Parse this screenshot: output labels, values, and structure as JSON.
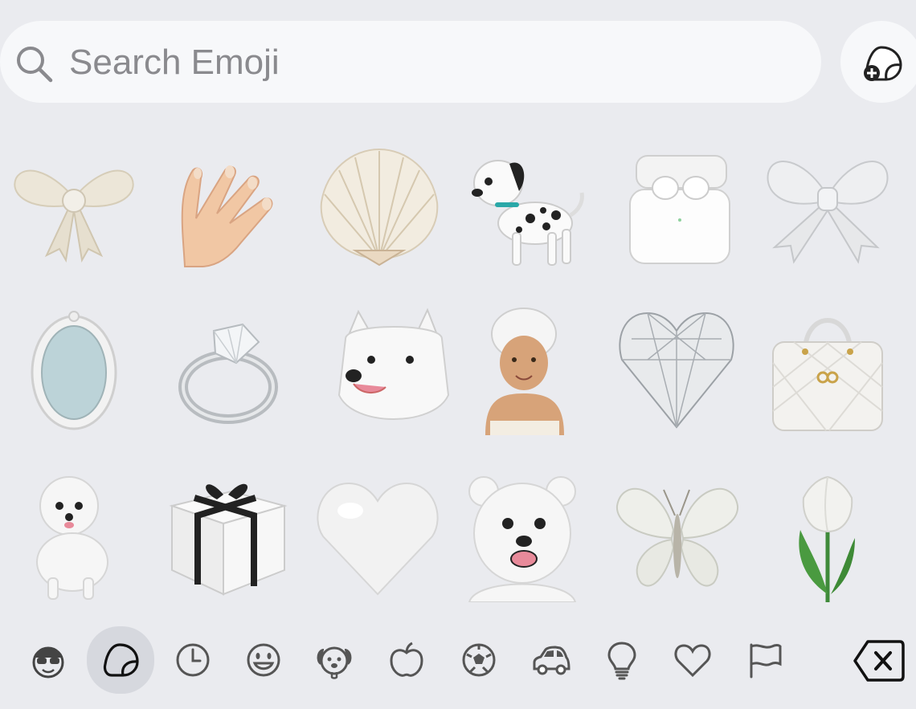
{
  "search": {
    "placeholder": "Search Emoji",
    "icon": "magnifier-icon"
  },
  "sticker_button": {
    "icon": "sticker-add-icon"
  },
  "emoji_grid": [
    [
      "white-bow",
      "nail-polish-hand",
      "scallop-shell",
      "dalmatian-dog",
      "airpods-case",
      "silver-bow"
    ],
    [
      "oval-mirror",
      "diamond-ring",
      "white-husky",
      "towel-woman",
      "diamond-heart",
      "quilted-handbag"
    ],
    [
      "maltese-dog",
      "gift-box",
      "white-heart",
      "polar-bear",
      "white-butterfly",
      "white-tulip"
    ]
  ],
  "categories": [
    {
      "name": "memoji",
      "icon": "memoji-icon",
      "active": false
    },
    {
      "name": "stickers",
      "icon": "sticker-icon",
      "active": true
    },
    {
      "name": "recent",
      "icon": "clock-icon",
      "active": false
    },
    {
      "name": "smileys",
      "icon": "smiley-icon",
      "active": false
    },
    {
      "name": "animals",
      "icon": "dog-icon",
      "active": false
    },
    {
      "name": "food",
      "icon": "apple-icon",
      "active": false
    },
    {
      "name": "activity",
      "icon": "soccer-ball-icon",
      "active": false
    },
    {
      "name": "travel",
      "icon": "car-icon",
      "active": false
    },
    {
      "name": "objects",
      "icon": "lightbulb-icon",
      "active": false
    },
    {
      "name": "symbols",
      "icon": "heart-outline-icon",
      "active": false
    },
    {
      "name": "flags",
      "icon": "flag-icon",
      "active": false
    }
  ],
  "delete_key": {
    "icon": "delete-backspace-icon"
  },
  "colors": {
    "background": "#eaebef",
    "field": "#f7f8fa",
    "active_category": "#d6d8de",
    "icon_gray": "#6e6e73"
  }
}
